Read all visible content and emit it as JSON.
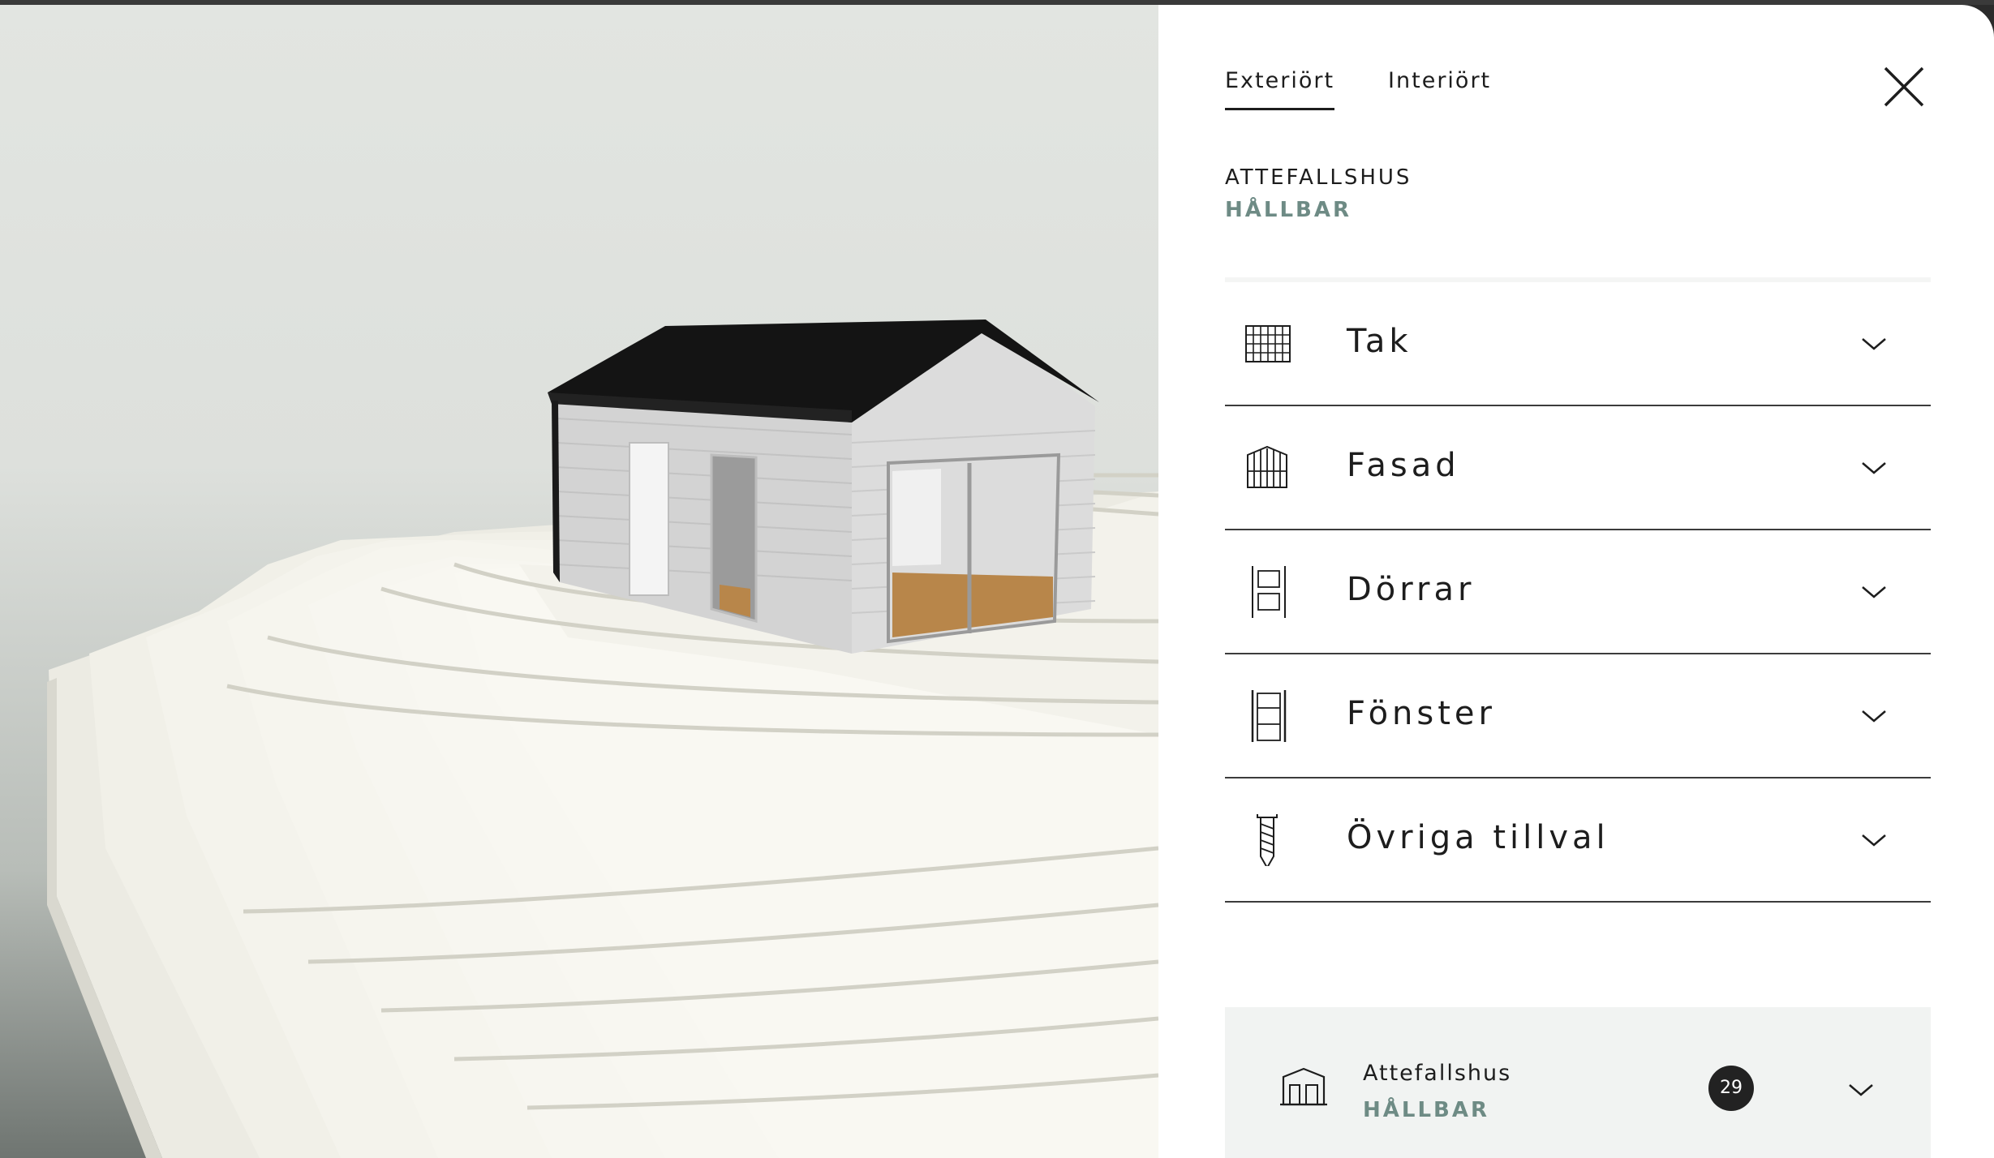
{
  "tabs": [
    {
      "label": "Exteriört",
      "active": true
    },
    {
      "label": "Interiört",
      "active": false
    }
  ],
  "product": {
    "title": "ATTEFALLSHUS",
    "subtitle": "HÅLLBAR"
  },
  "accordion": [
    {
      "label": "Tak",
      "icon": "roof-tiles-icon"
    },
    {
      "label": "Fasad",
      "icon": "facade-icon"
    },
    {
      "label": "Dörrar",
      "icon": "door-icon"
    },
    {
      "label": "Fönster",
      "icon": "window-icon"
    },
    {
      "label": "Övriga tillval",
      "icon": "screw-icon"
    }
  ],
  "summary": {
    "title": "Attefallshus",
    "subtitle": "HÅLLBAR",
    "count": "29",
    "icon": "house-icon"
  },
  "colors": {
    "accent_subtitle": "#6e8b85",
    "badge_bg": "#222222",
    "summary_bg": "#f1f3f2",
    "divider": "#3c3c3c"
  }
}
